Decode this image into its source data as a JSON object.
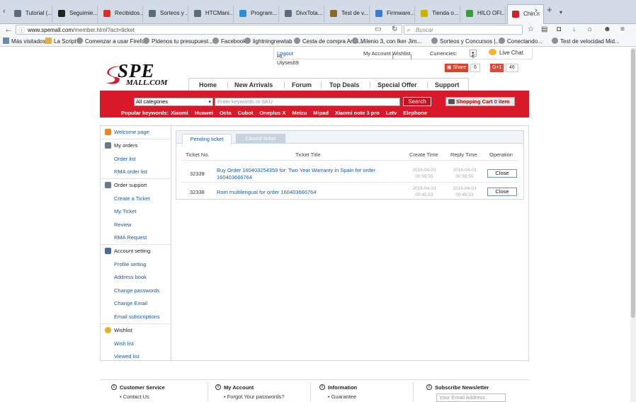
{
  "browser": {
    "tabs": [
      {
        "title": "Tutorial (...",
        "icon": "tab-favicon-icon",
        "color": "#5b6b7a"
      },
      {
        "title": "Seguimie...",
        "icon": "amazon-favicon-icon",
        "color": "#222222"
      },
      {
        "title": "Recibidos...",
        "icon": "gmail-favicon-icon",
        "color": "#d93025"
      },
      {
        "title": "Sorteos y ...",
        "icon": "tab-favicon-icon",
        "color": "#5b6b7a"
      },
      {
        "title": "HTCMani...",
        "icon": "tab-favicon-icon",
        "color": "#5b6b7a"
      },
      {
        "title": "Program...",
        "icon": "plus-favicon-icon",
        "color": "#2a8fd8"
      },
      {
        "title": "DivxTota...",
        "icon": "tab-favicon-icon",
        "color": "#5b6b7a"
      },
      {
        "title": "Test de v...",
        "icon": "tab-favicon-icon",
        "color": "#8a6a2a"
      },
      {
        "title": "Firmware...",
        "icon": "tab-favicon-icon",
        "color": "#3a7bd5"
      },
      {
        "title": "Tienda o...",
        "icon": "tab-favicon-icon",
        "color": "#c8b400"
      },
      {
        "title": "HILO OFI...",
        "icon": "tab-favicon-icon",
        "color": "#3a9c3a"
      },
      {
        "title": "Chin...",
        "icon": "spemall-favicon-icon",
        "color": "#d8192a"
      }
    ],
    "new_tab": "+",
    "tab_list": "▾",
    "url_domain": "www.spemall.com",
    "url_path": "/member.html?act=ticket",
    "search_placeholder": "Buscar",
    "bookmarks": [
      "Más visitados",
      "La Script",
      "Comenzar a usar Firefox",
      "Pídenos tu presupuest...",
      "Facebook",
      "lightningnewtab",
      "Cesta de compra Ama...",
      "Milenio 3, con Iker Jim...",
      "Sorteos y Concursos |...",
      "Conectando...",
      "Test de velocidad Mid..."
    ]
  },
  "top": {
    "greeting": "Hi, Ulyses69",
    "logout": "Logout",
    "my_account": "My Account",
    "wishlist": "Wishlist",
    "sep": "|",
    "currencies_label": "Currencies:",
    "currency_value": "€",
    "live_chat": "Live Chat"
  },
  "logo": {
    "line1": "SPE",
    "line2": "MALL.COM"
  },
  "share": {
    "share_label": "Share",
    "share_count": "6",
    "gplus_label": "G+1",
    "gplus_count": "46"
  },
  "nav": [
    "Home",
    "New Arrivals",
    "Forum",
    "Top Deals",
    "Special Offer",
    "Support"
  ],
  "searchbar": {
    "category": "All categories",
    "placeholder": "Enter keywords or SKU",
    "search_label": "Search",
    "cart_label": "Shopping Cart",
    "cart_count": "0",
    "cart_unit": "item",
    "popular_label": "Popular keywords:",
    "keywords": [
      "Xiaomi",
      "Huawei",
      "Octa",
      "Cubot",
      "Oneplus X",
      "Meizu",
      "Mipad",
      "Xiaomi note 3 pro",
      "Letv",
      "Elephone"
    ]
  },
  "sidebar": {
    "welcome": "Welcome page",
    "my_orders": "My orders",
    "order_list": "Order list",
    "rma_order_list": "RMA order list",
    "order_support": "Order support",
    "create_ticket": "Create a Ticket",
    "my_ticket": "My Ticket",
    "review": "Review",
    "rma_request": "RMA Request",
    "account_setting": "Account setting",
    "profile_setting": "Profile setting",
    "address_book": "Address book",
    "change_passwords": "Change passwords",
    "change_email": "Change Email",
    "email_subscriptions": "Email subscriptions",
    "wishlist": "Wishlist",
    "wish_list": "Wish list",
    "viewed_list": "Viewed list"
  },
  "tickets": {
    "tab_pending": "Pending ticket",
    "tab_closed": "Closed ticket",
    "headers": {
      "no": "Ticket No.",
      "title": "Ticket Title",
      "create": "Create Time",
      "reply": "Reply Time",
      "op": "Operation"
    },
    "rows": [
      {
        "no": "32339",
        "title": "Buy Order 160403254359 for: Two Year Warranty in Spain for order 160403666764",
        "create_date": "2016-04-03",
        "create_time": "00:59:55",
        "reply_date": "2016-04-03",
        "reply_time": "00:59:55",
        "action": "Close"
      },
      {
        "no": "32338",
        "title": "Rom multilengual for order 160403666764",
        "create_date": "2016-04-03",
        "create_time": "00:45:53",
        "reply_date": "2016-04-03",
        "reply_time": "00:45:53",
        "action": "Close"
      }
    ]
  },
  "footer": {
    "customer_service": "Customer Service",
    "contact_us": "• Contact Us",
    "my_account": "My Account",
    "forgot": "• Forgot Your passwords?",
    "information": "Information",
    "guarantee": "• Guarantee",
    "newsletter": "Subscribe Newsletter",
    "email_placeholder": "Your Email Address"
  },
  "colors": {
    "brand_red": "#d8192a",
    "link_blue": "#1a5aa8"
  }
}
